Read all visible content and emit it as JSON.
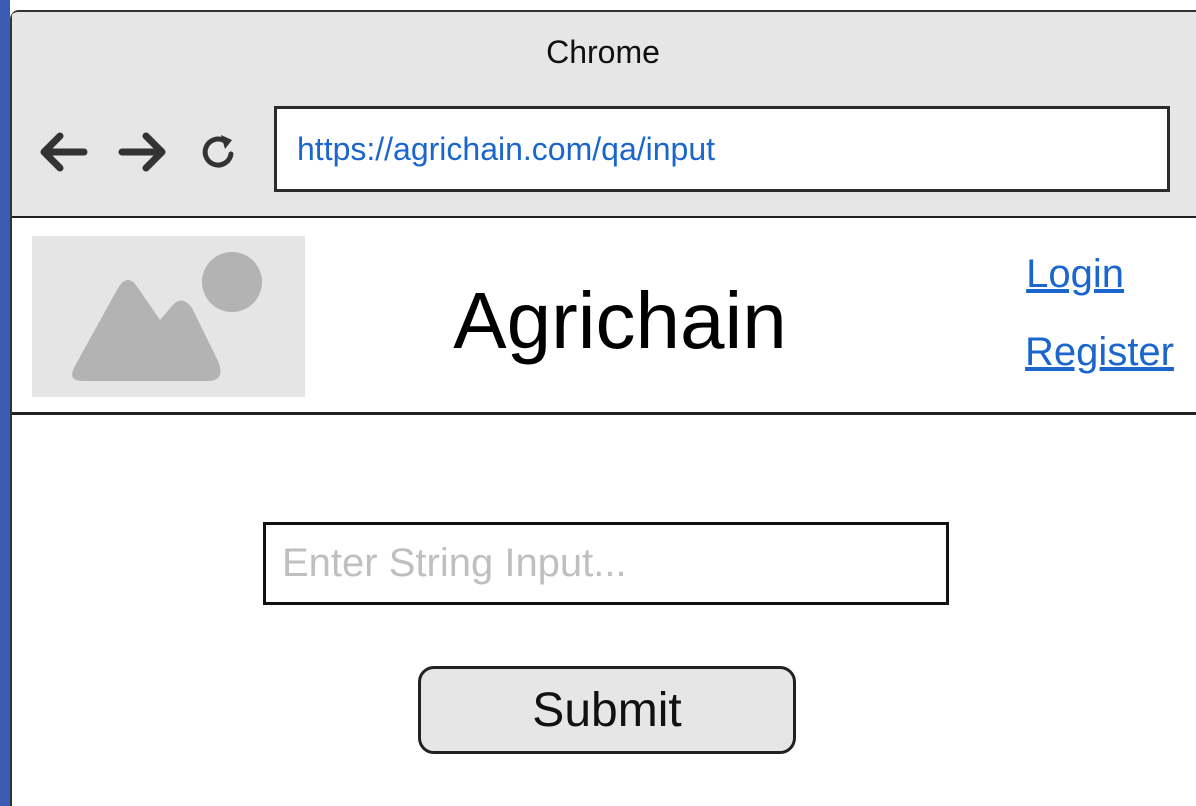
{
  "browser": {
    "title": "Chrome",
    "url": "https://agrichain.com/qa/input",
    "icons": {
      "back": "arrow-left-icon",
      "forward": "arrow-right-icon",
      "reload": "reload-icon"
    }
  },
  "header": {
    "logo": "image-placeholder-icon",
    "title": "Agrichain",
    "links": {
      "login": "Login",
      "register": "Register"
    }
  },
  "form": {
    "input_placeholder": "Enter String Input...",
    "input_value": "",
    "submit_label": "Submit"
  },
  "colors": {
    "chrome_bg": "#e6e6e6",
    "link": "#1a66cc",
    "placeholder": "#bfbfbf",
    "logo_bg": "#e5e5e5",
    "logo_shape": "#b3b3b3"
  }
}
